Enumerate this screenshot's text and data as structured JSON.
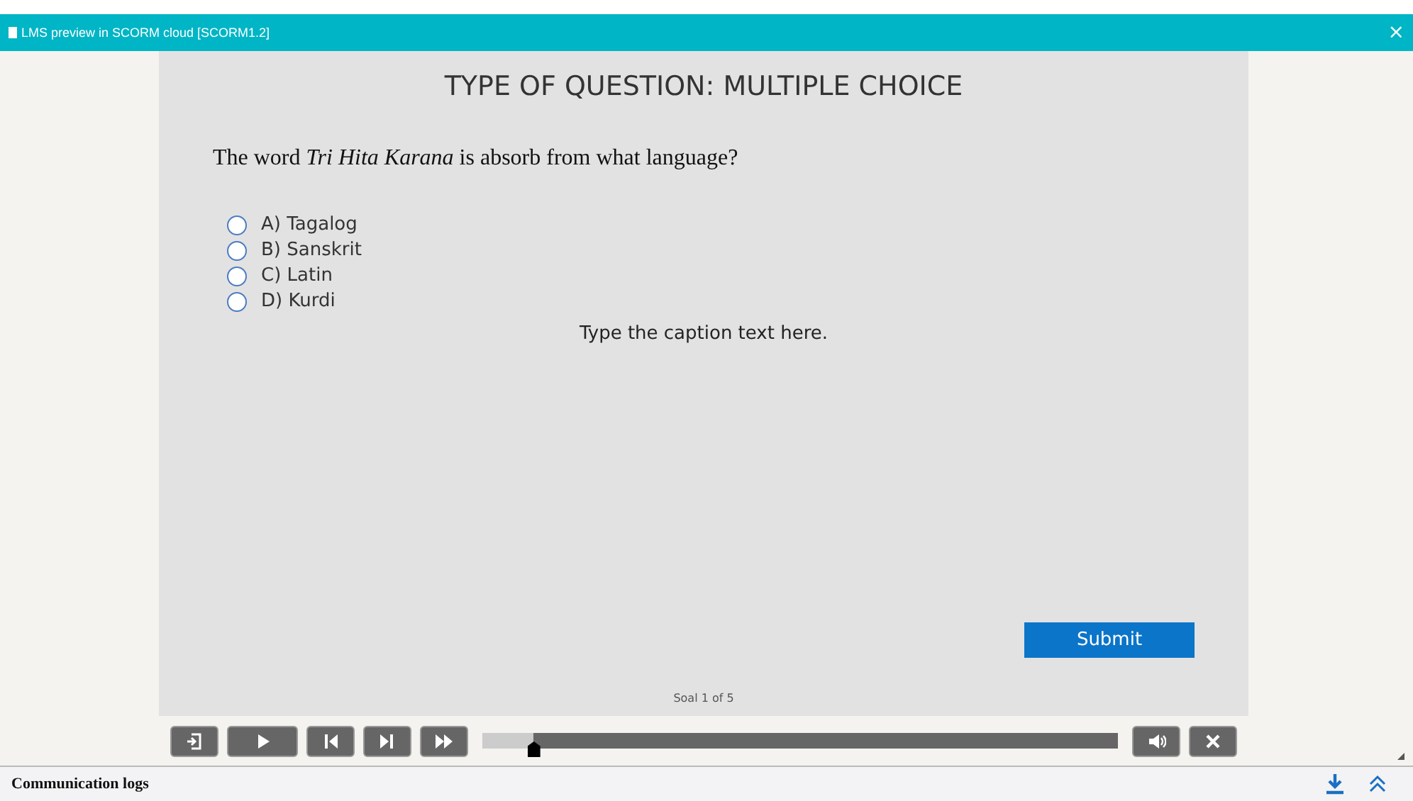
{
  "window": {
    "title": "LMS preview in SCORM cloud [SCORM1.2]",
    "close": "×"
  },
  "slide": {
    "heading": "TYPE OF QUESTION: MULTIPLE CHOICE",
    "question": "The word *Tri Hita Karana* is absorb from what language?",
    "options": [
      {
        "label": "A) Tagalog",
        "selected": false
      },
      {
        "label": "B) Sanskrit",
        "selected": false
      },
      {
        "label": "C) Latin",
        "selected": false
      },
      {
        "label": "D) Kurdi",
        "selected": false
      }
    ],
    "caption": "Type the caption text here.",
    "submit": "Submit",
    "counter": "Soal 1 of 5"
  },
  "player": {
    "controls": [
      {
        "kind": "exit"
      },
      {
        "kind": "play"
      },
      {
        "kind": "prev"
      },
      {
        "kind": "next"
      },
      {
        "kind": "forward"
      }
    ],
    "progress": {
      "level": 0.08
    },
    "right_controls": [
      {
        "kind": "volume"
      },
      {
        "kind": "close"
      }
    ]
  },
  "status_bar": {
    "label": "Communication logs"
  }
}
